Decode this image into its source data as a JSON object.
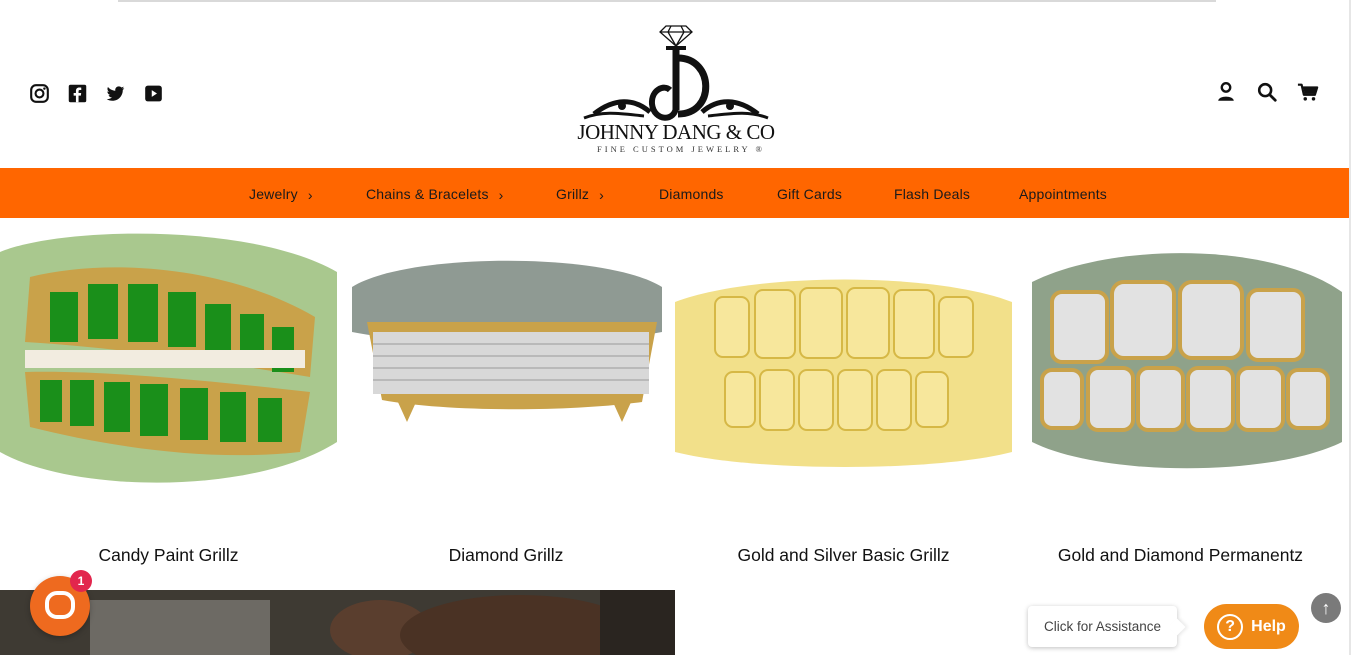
{
  "header": {
    "brand_name": "JOHNNY DANG & CO",
    "brand_tagline": "FINE CUSTOM JEWELRY ®",
    "social_icons": [
      "instagram-icon",
      "facebook-icon",
      "twitter-icon",
      "youtube-icon"
    ],
    "utility_icons": [
      "account-icon",
      "search-icon",
      "cart-icon"
    ]
  },
  "nav": {
    "items": [
      {
        "label": "Jewelry",
        "has_submenu": true
      },
      {
        "label": "Chains & Bracelets",
        "has_submenu": true
      },
      {
        "label": "Grillz",
        "has_submenu": true
      },
      {
        "label": "Diamonds",
        "has_submenu": false
      },
      {
        "label": "Gift Cards",
        "has_submenu": false
      },
      {
        "label": "Flash Deals",
        "has_submenu": false
      },
      {
        "label": "Appointments",
        "has_submenu": false
      }
    ],
    "chevron": "›"
  },
  "products": [
    {
      "title": "Candy Paint Grillz"
    },
    {
      "title": "Diamond Grillz"
    },
    {
      "title": "Gold and Silver Basic Grillz"
    },
    {
      "title": "Gold and Diamond Permanentz"
    }
  ],
  "chat": {
    "badge_count": "1",
    "assist_text": "Click for Assistance",
    "help_label": "Help",
    "help_glyph": "?",
    "scroll_top_glyph": "↑"
  },
  "colors": {
    "nav_bg": "#ff6600",
    "chat_orange": "#ee6a1f",
    "help_orange": "#f08a17",
    "badge_red": "#e2264d"
  }
}
